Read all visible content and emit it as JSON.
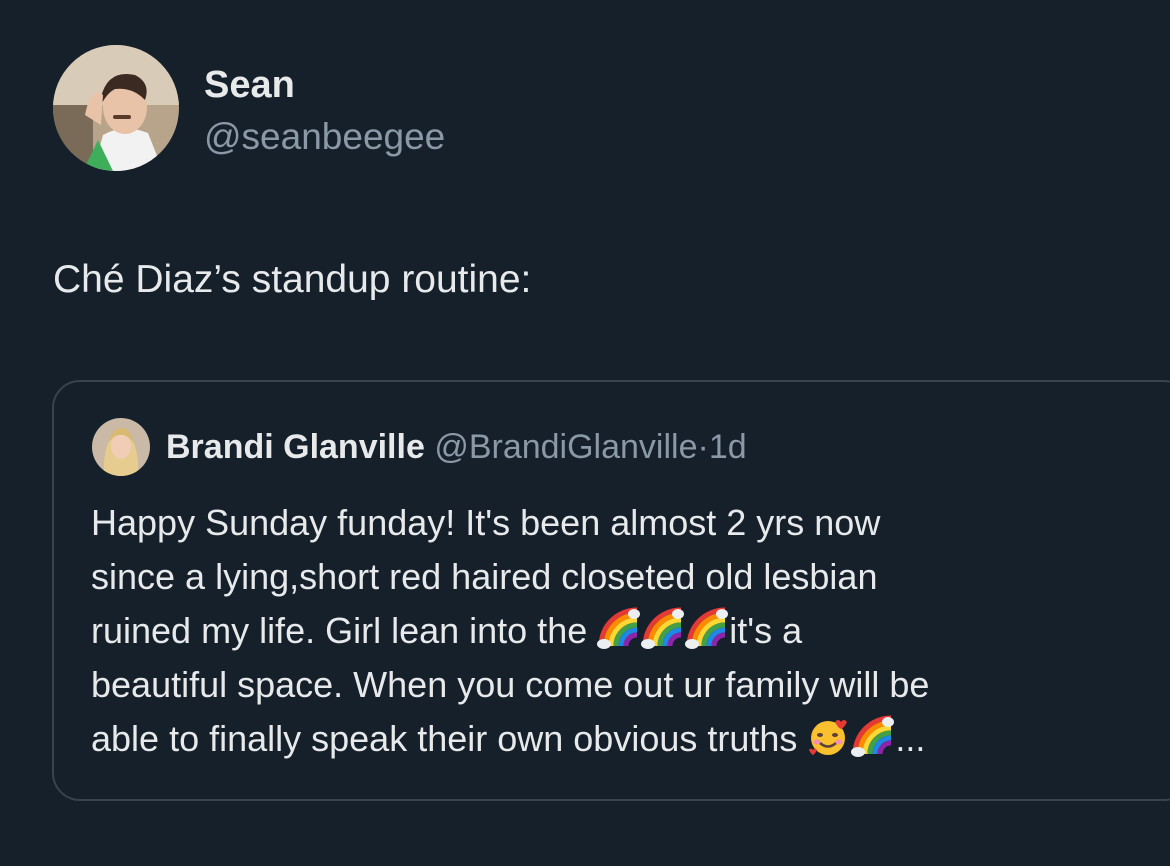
{
  "author": {
    "display_name": "Sean",
    "handle": "@seanbeegee",
    "avatar_icon": "profile-photo"
  },
  "tweet": {
    "text": "Ché Diaz’s standup routine:"
  },
  "quoted_tweet": {
    "display_name": "Brandi Glanville",
    "handle": "@BrandiGlanville",
    "separator": "·",
    "time": "1d",
    "avatar_icon": "profile-photo",
    "lines": [
      "Happy Sunday funday! It's been almost 2 yrs now",
      "since a lying,short red haired closeted old lesbian",
      "ruined my life. Girl lean into the ",
      "beautiful space. When you come out ur family will be",
      "able to finally speak their own obvious  truths "
    ],
    "line3_tail": "it's a",
    "ellipsis": "...",
    "emojis": [
      "rainbow",
      "smiling-face-with-hearts"
    ]
  },
  "colors": {
    "background": "#15202b",
    "text": "#e7e9ea",
    "secondary_text": "#8b98a5",
    "card_border": "#38444d"
  }
}
